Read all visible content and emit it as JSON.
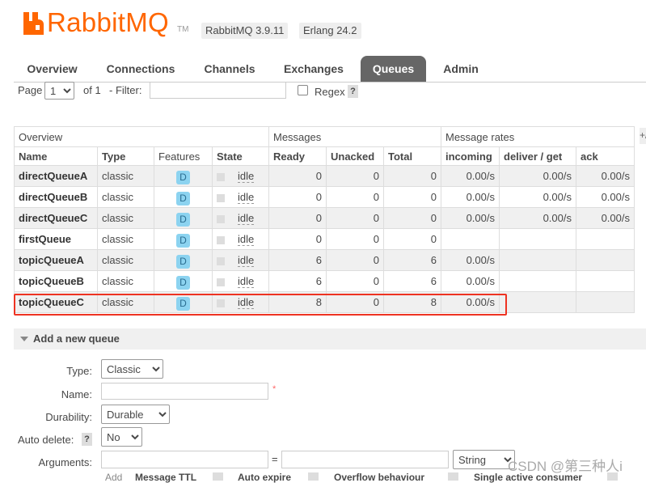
{
  "header": {
    "logo_text": "RabbitMQ",
    "logo_rabbit": "Rabbit",
    "logo_mq": "MQ",
    "trademark": "TM",
    "rabbitmq_version": "RabbitMQ 3.9.11",
    "erlang_version": "Erlang 24.2",
    "brand_color": "#ff6600"
  },
  "tabs": [
    {
      "label": "Overview"
    },
    {
      "label": "Connections"
    },
    {
      "label": "Channels"
    },
    {
      "label": "Exchanges"
    },
    {
      "label": "Queues",
      "active": true
    },
    {
      "label": "Admin"
    }
  ],
  "paging": {
    "page_label": "Page",
    "page_value": "1",
    "of_label": "of 1",
    "filter_label": "- Filter:",
    "filter_value": "",
    "regex_label": "Regex",
    "help": "?"
  },
  "table": {
    "group_headers": [
      "Overview",
      "Messages",
      "Message rates"
    ],
    "plus_minus": "+/-",
    "columns": [
      "Name",
      "Type",
      "Features",
      "State",
      "Ready",
      "Unacked",
      "Total",
      "incoming",
      "deliver / get",
      "ack"
    ],
    "rows": [
      {
        "name": "directQueueA",
        "type": "classic",
        "feature": "D",
        "state": "idle",
        "ready": "0",
        "unacked": "0",
        "total": "0",
        "incoming": "0.00/s",
        "deliver": "0.00/s",
        "ack": "0.00/s"
      },
      {
        "name": "directQueueB",
        "type": "classic",
        "feature": "D",
        "state": "idle",
        "ready": "0",
        "unacked": "0",
        "total": "0",
        "incoming": "0.00/s",
        "deliver": "0.00/s",
        "ack": "0.00/s"
      },
      {
        "name": "directQueueC",
        "type": "classic",
        "feature": "D",
        "state": "idle",
        "ready": "0",
        "unacked": "0",
        "total": "0",
        "incoming": "0.00/s",
        "deliver": "0.00/s",
        "ack": "0.00/s"
      },
      {
        "name": "firstQueue",
        "type": "classic",
        "feature": "D",
        "state": "idle",
        "ready": "0",
        "unacked": "0",
        "total": "0",
        "incoming": "",
        "deliver": "",
        "ack": ""
      },
      {
        "name": "topicQueueA",
        "type": "classic",
        "feature": "D",
        "state": "idle",
        "ready": "6",
        "unacked": "0",
        "total": "6",
        "incoming": "0.00/s",
        "deliver": "",
        "ack": ""
      },
      {
        "name": "topicQueueB",
        "type": "classic",
        "feature": "D",
        "state": "idle",
        "ready": "6",
        "unacked": "0",
        "total": "6",
        "incoming": "0.00/s",
        "deliver": "",
        "ack": ""
      },
      {
        "name": "topicQueueC",
        "type": "classic",
        "feature": "D",
        "state": "idle",
        "ready": "8",
        "unacked": "0",
        "total": "8",
        "incoming": "0.00/s",
        "deliver": "",
        "ack": "",
        "highlighted": true
      }
    ],
    "highlight_color": "#ee3322"
  },
  "add_queue": {
    "title": "Add a new queue",
    "type_label": "Type:",
    "type_value": "Classic",
    "name_label": "Name:",
    "name_value": "",
    "required_mark": "*",
    "durability_label": "Durability:",
    "durability_value": "Durable",
    "auto_delete_label": "Auto delete:",
    "auto_delete_value": "No",
    "arguments_label": "Arguments:",
    "arguments_eq": "=",
    "arguments_type": "String",
    "add_label": "Add",
    "arg_links": [
      "Message TTL",
      "Auto expire",
      "Overflow behaviour",
      "Single active consumer"
    ]
  },
  "watermark": "CSDN @第三种人i"
}
